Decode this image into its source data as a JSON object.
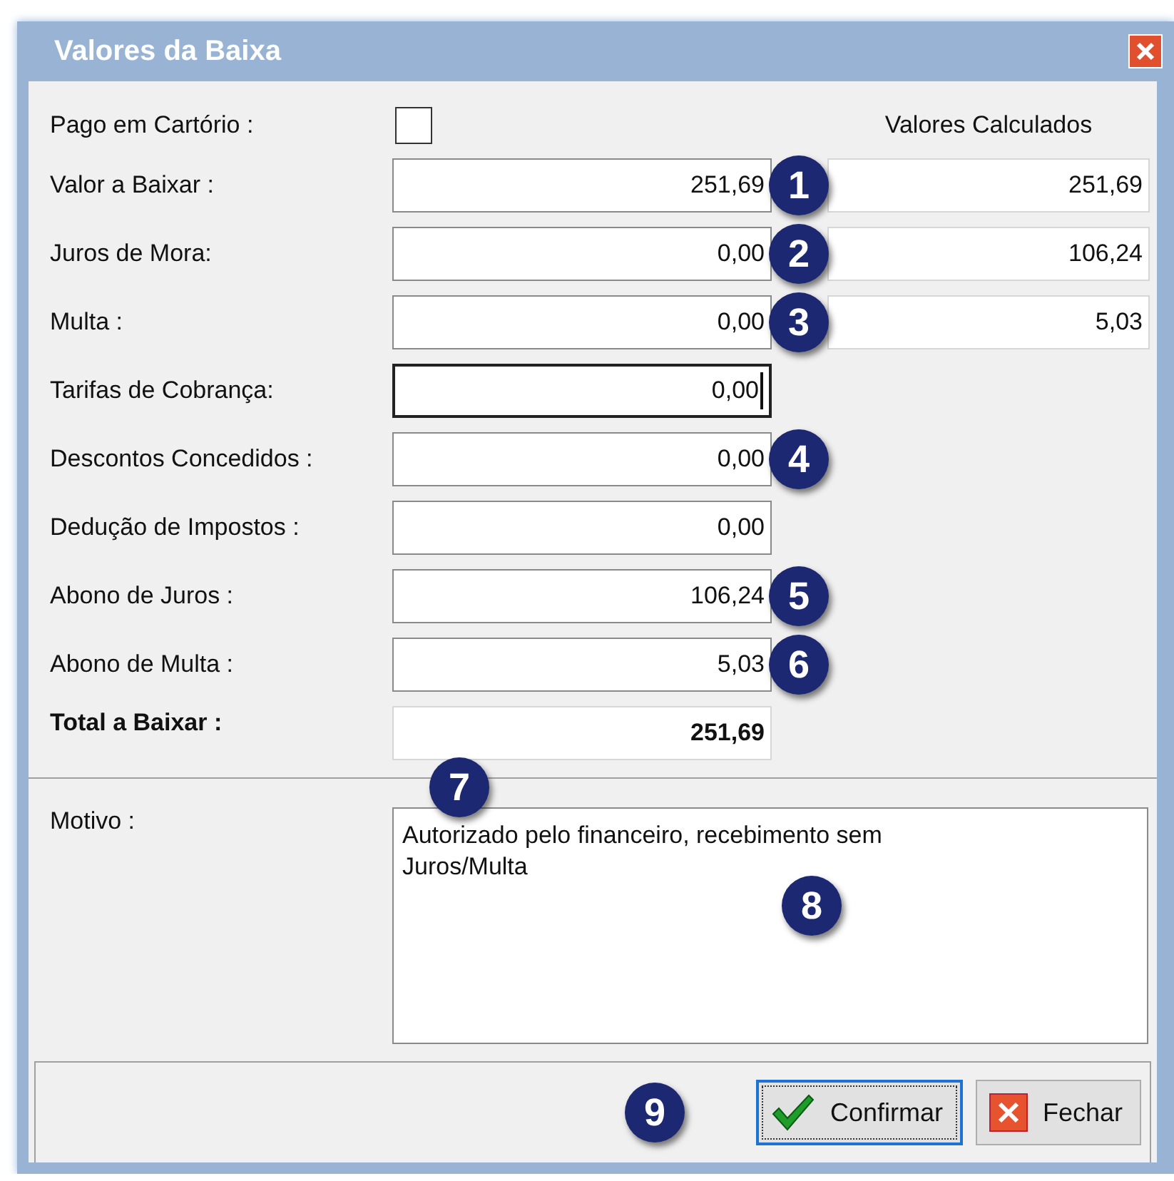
{
  "window": {
    "title": "Valores da Baixa"
  },
  "paid_at_notary": {
    "label": "Pago em Cartório :",
    "checked": false
  },
  "calculated_heading": "Valores Calculados",
  "rows": [
    {
      "label": "Valor a Baixar :",
      "value": "251,69",
      "calculated": "251,69",
      "focused": false,
      "badge": "1"
    },
    {
      "label": "Juros de Mora:",
      "value": "0,00",
      "calculated": "106,24",
      "focused": false,
      "badge": "2"
    },
    {
      "label": "Multa :",
      "value": "0,00",
      "calculated": "5,03",
      "focused": false,
      "badge": "3"
    },
    {
      "label": "Tarifas de Cobrança:",
      "value": "0,00",
      "focused": true
    },
    {
      "label": "Descontos Concedidos :",
      "value": "0,00",
      "focused": false,
      "badge": "4"
    },
    {
      "label": "Dedução de Impostos :",
      "value": "0,00",
      "focused": false
    },
    {
      "label": "Abono de Juros :",
      "value": "106,24",
      "focused": false,
      "badge": "5"
    },
    {
      "label": "Abono de Multa :",
      "value": "5,03",
      "focused": false,
      "badge": "6"
    }
  ],
  "total": {
    "label": "Total a Baixar :",
    "value": "251,69",
    "badge": "7"
  },
  "reason": {
    "label": "Motivo :",
    "value": "Autorizado pelo financeiro, recebimento sem\nJuros/Multa",
    "badge": "8"
  },
  "buttons": [
    {
      "label": "Confirmar",
      "kind": "confirm",
      "focused": true
    },
    {
      "label": "Fechar",
      "kind": "close",
      "focused": false
    }
  ],
  "footer_badge": "9"
}
